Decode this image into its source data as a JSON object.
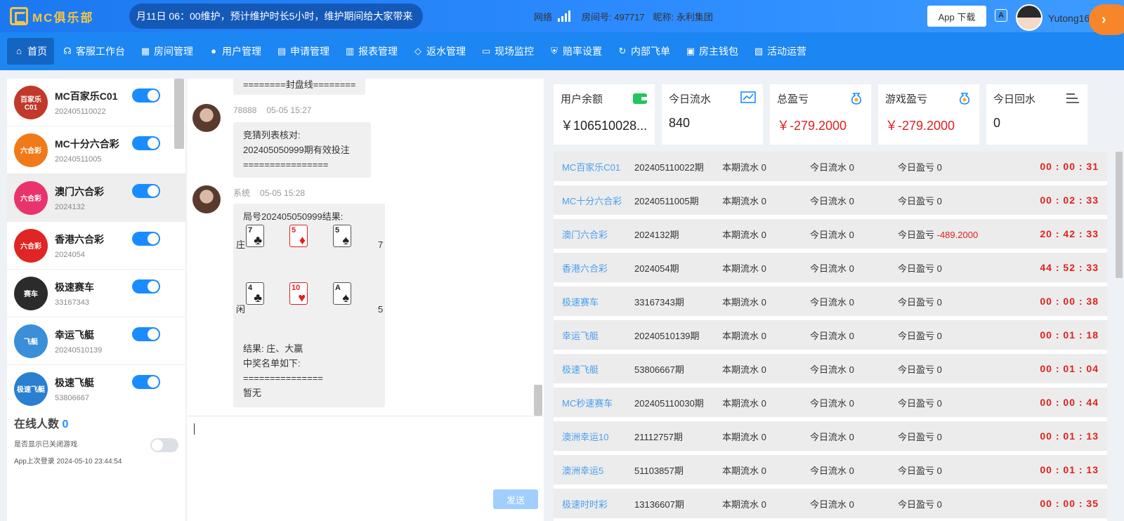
{
  "header": {
    "logo_text": "MC俱乐部",
    "marquee": "月11日 06：00维护，预计维护时长5小时，维护期间给大家带来",
    "network_label": "网络",
    "room_label": "房间号: 497717",
    "nickname_label": "昵称: 永利集团",
    "app_download": "App 下载",
    "lang_icon_text": "A",
    "username": "Yutong168"
  },
  "nav": {
    "items": [
      {
        "label": "首页",
        "icon": "home-icon"
      },
      {
        "label": "客服工作台",
        "icon": "headset-icon"
      },
      {
        "label": "房间管理",
        "icon": "grid-icon"
      },
      {
        "label": "用户管理",
        "icon": "user-icon"
      },
      {
        "label": "申请管理",
        "icon": "document-icon"
      },
      {
        "label": "报表管理",
        "icon": "bar-chart-icon"
      },
      {
        "label": "返水管理",
        "icon": "tag-icon"
      },
      {
        "label": "现场监控",
        "icon": "monitor-icon"
      },
      {
        "label": "赔率设置",
        "icon": "shield-icon"
      },
      {
        "label": "内部飞单",
        "icon": "refresh-icon"
      },
      {
        "label": "房主钱包",
        "icon": "wallet-icon"
      },
      {
        "label": "活动运营",
        "icon": "gift-icon"
      }
    ],
    "more_arrow": "›"
  },
  "games": [
    {
      "name": "MC百家乐C01",
      "code": "202405110022",
      "logo_text": "百家乐C01",
      "color": "#c0392b",
      "enabled": true
    },
    {
      "name": "MC十分六合彩",
      "code": "20240511005",
      "logo_text": "六合彩",
      "color": "#f07a1a",
      "enabled": true
    },
    {
      "name": "澳门六合彩",
      "code": "2024132",
      "logo_text": "六合彩",
      "color": "#e8336d",
      "enabled": true
    },
    {
      "name": "香港六合彩",
      "code": "2024054",
      "logo_text": "六合彩",
      "color": "#e02525",
      "enabled": true
    },
    {
      "name": "极速赛车",
      "code": "33167343",
      "logo_text": "赛车",
      "color": "#2b2b2b",
      "enabled": true
    },
    {
      "name": "幸运飞艇",
      "code": "20240510139",
      "logo_text": "飞艇",
      "color": "#3a8fd8",
      "enabled": true
    },
    {
      "name": "极速飞艇",
      "code": "53806667",
      "logo_text": "极速飞艇",
      "color": "#2a7fd0",
      "enabled": true
    }
  ],
  "online": {
    "label": "在线人数",
    "count": "0",
    "show_closed_label": "是否显示已关闭游戏",
    "last_login": "App上次登录 2024-05-10 23:44:54"
  },
  "chat": {
    "top_bubble": "========封盘线========",
    "msg1_sender": "78888",
    "msg1_time": "05-05 15:27",
    "msg1_line1": "竞猜列表核对:",
    "msg1_line2": "202405050999期有效投注",
    "msg1_line3": "================",
    "msg2_sender": "系统",
    "msg2_time": "05-05 15:28",
    "msg2_title": "局号202405050999结果:",
    "banker_label": "庄",
    "banker_points": "7",
    "player_label": "闲",
    "player_points": "5",
    "banker_cards": [
      {
        "rank": "7",
        "suit": "♣",
        "color": "black"
      },
      {
        "rank": "5",
        "suit": "♦",
        "color": "red"
      },
      {
        "rank": "5",
        "suit": "♠",
        "color": "black"
      }
    ],
    "player_cards": [
      {
        "rank": "4",
        "suit": "♣",
        "color": "black"
      },
      {
        "rank": "10",
        "suit": "♥",
        "color": "red"
      },
      {
        "rank": "A",
        "suit": "♠",
        "color": "black"
      }
    ],
    "result_line": "结果: 庄、大赢",
    "winners_label": "中奖名单如下:",
    "separator": "===============",
    "winners_none": "暂无",
    "send_button": "发送"
  },
  "stats": [
    {
      "label": "用户余额",
      "value": "￥106510028...",
      "icon": "wallet-icon",
      "color": "#22c55e",
      "red": false
    },
    {
      "label": "今日流水",
      "value": "840",
      "icon": "chart-line-icon",
      "color": "#1a8cff",
      "red": false
    },
    {
      "label": "总盈亏",
      "value": "￥-279.2000",
      "icon": "money-bag-icon",
      "color": "#1a8cff",
      "red": true
    },
    {
      "label": "游戏盈亏",
      "value": "￥-279.2000",
      "icon": "money-bag-icon",
      "color": "#1a8cff",
      "red": true
    },
    {
      "label": "今日回水",
      "value": "0",
      "icon": "list-icon",
      "color": "#333333",
      "red": false
    }
  ],
  "rows": [
    {
      "name": "MC百家乐C01",
      "period": "202405110022期",
      "cur": "本期流水 0",
      "today": "今日流水 0",
      "profit_label": "今日盈亏 ",
      "profit": "0",
      "neg": false,
      "time": "00 : 00 : 31"
    },
    {
      "name": "MC十分六合彩",
      "period": "20240511005期",
      "cur": "本期流水 0",
      "today": "今日流水 0",
      "profit_label": "今日盈亏 ",
      "profit": "0",
      "neg": false,
      "time": "00 : 02 : 33"
    },
    {
      "name": "澳门六合彩",
      "period": "2024132期",
      "cur": "本期流水 0",
      "today": "今日流水 0",
      "profit_label": "今日盈亏 ",
      "profit": "-489.2000",
      "neg": true,
      "time": "20 : 42 : 33"
    },
    {
      "name": "香港六合彩",
      "period": "2024054期",
      "cur": "本期流水 0",
      "today": "今日流水 0",
      "profit_label": "今日盈亏 ",
      "profit": "0",
      "neg": false,
      "time": "44 : 52 : 33"
    },
    {
      "name": "极速赛车",
      "period": "33167343期",
      "cur": "本期流水 0",
      "today": "今日流水 0",
      "profit_label": "今日盈亏 ",
      "profit": "0",
      "neg": false,
      "time": "00 : 00 : 38"
    },
    {
      "name": "幸运飞艇",
      "period": "20240510139期",
      "cur": "本期流水 0",
      "today": "今日流水 0",
      "profit_label": "今日盈亏 ",
      "profit": "0",
      "neg": false,
      "time": "00 : 01 : 18"
    },
    {
      "name": "极速飞艇",
      "period": "53806667期",
      "cur": "本期流水 0",
      "today": "今日流水 0",
      "profit_label": "今日盈亏 ",
      "profit": "0",
      "neg": false,
      "time": "00 : 01 : 04"
    },
    {
      "name": "MC秒速赛车",
      "period": "202405110030期",
      "cur": "本期流水 0",
      "today": "今日流水 0",
      "profit_label": "今日盈亏 ",
      "profit": "0",
      "neg": false,
      "time": "00 : 00 : 44"
    },
    {
      "name": "澳洲幸运10",
      "period": "21112757期",
      "cur": "本期流水 0",
      "today": "今日流水 0",
      "profit_label": "今日盈亏 ",
      "profit": "0",
      "neg": false,
      "time": "00 : 01 : 13"
    },
    {
      "name": "澳洲幸运5",
      "period": "51103857期",
      "cur": "本期流水 0",
      "today": "今日流水 0",
      "profit_label": "今日盈亏 ",
      "profit": "0",
      "neg": false,
      "time": "00 : 01 : 13"
    },
    {
      "name": "极速时时彩",
      "period": "13136607期",
      "cur": "本期流水 0",
      "today": "今日流水 0",
      "profit_label": "今日盈亏 ",
      "profit": "0",
      "neg": false,
      "time": "00 : 00 : 35"
    }
  ]
}
